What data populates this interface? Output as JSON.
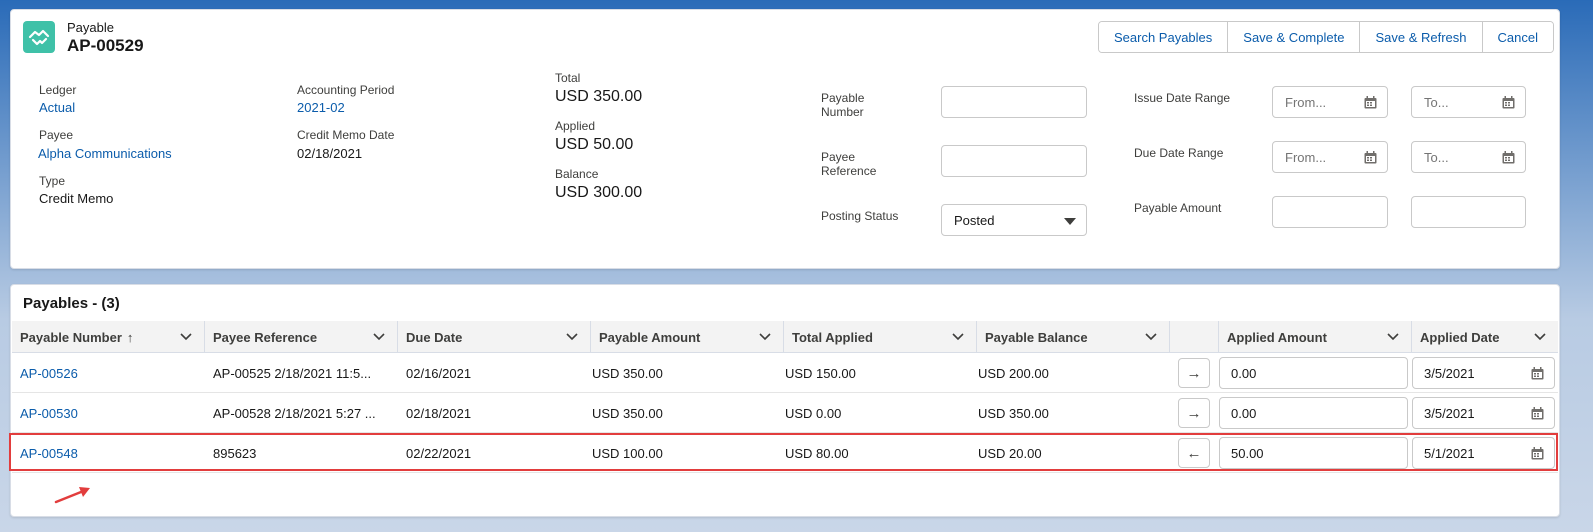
{
  "header": {
    "object_type": "Payable",
    "record_name": "AP-00529",
    "buttons": [
      "Search Payables",
      "Save & Complete",
      "Save & Refresh",
      "Cancel"
    ]
  },
  "details": {
    "ledger_label": "Ledger",
    "ledger_value": "Actual",
    "payee_label": "Payee",
    "payee_value": "Alpha Communications",
    "type_label": "Type",
    "type_value": "Credit Memo",
    "period_label": "Accounting Period",
    "period_value": "2021-02",
    "memo_date_label": "Credit Memo Date",
    "memo_date_value": "02/18/2021",
    "total_label": "Total",
    "total_value": "USD 350.00",
    "applied_label": "Applied",
    "applied_value": "USD 50.00",
    "balance_label": "Balance",
    "balance_value": "USD 300.00"
  },
  "filters": {
    "payable_number_label_1": "Payable",
    "payable_number_label_2": "Number",
    "payable_number_value": "",
    "payee_reference_label_1": "Payee",
    "payee_reference_label_2": "Reference",
    "payee_reference_value": "",
    "posting_status_label": "Posting Status",
    "posting_status_value": "Posted",
    "issue_date_label": "Issue Date Range",
    "due_date_label": "Due Date Range",
    "payable_amount_label": "Payable Amount",
    "from_placeholder": "From...",
    "to_placeholder": "To..."
  },
  "table": {
    "title": "Payables - (3)",
    "columns": [
      "Payable Number",
      "Payee Reference",
      "Due Date",
      "Payable Amount",
      "Total Applied",
      "Payable Balance",
      "",
      "Applied Amount",
      "Applied Date"
    ],
    "sort_indicator": "↑",
    "rows": [
      {
        "number": "AP-00526",
        "reference": "AP-00525 2/18/2021 11:5...",
        "due": "02/16/2021",
        "amount": "USD 350.00",
        "applied": "USD 150.00",
        "balance": "USD 200.00",
        "arrow": "→",
        "applied_amount": "0.00",
        "applied_date": "3/5/2021"
      },
      {
        "number": "AP-00530",
        "reference": "AP-00528 2/18/2021 5:27 ...",
        "due": "02/18/2021",
        "amount": "USD 350.00",
        "applied": "USD 0.00",
        "balance": "USD 350.00",
        "arrow": "→",
        "applied_amount": "0.00",
        "applied_date": "3/5/2021"
      },
      {
        "number": "AP-00548",
        "reference": "895623",
        "due": "02/22/2021",
        "amount": "USD 100.00",
        "applied": "USD 80.00",
        "balance": "USD 20.00",
        "arrow": "←",
        "applied_amount": "50.00",
        "applied_date": "5/1/2021"
      }
    ]
  },
  "colors": {
    "link": "#0b5cab",
    "app_icon": "#3fc1a8",
    "highlight": "#e23d3d"
  }
}
